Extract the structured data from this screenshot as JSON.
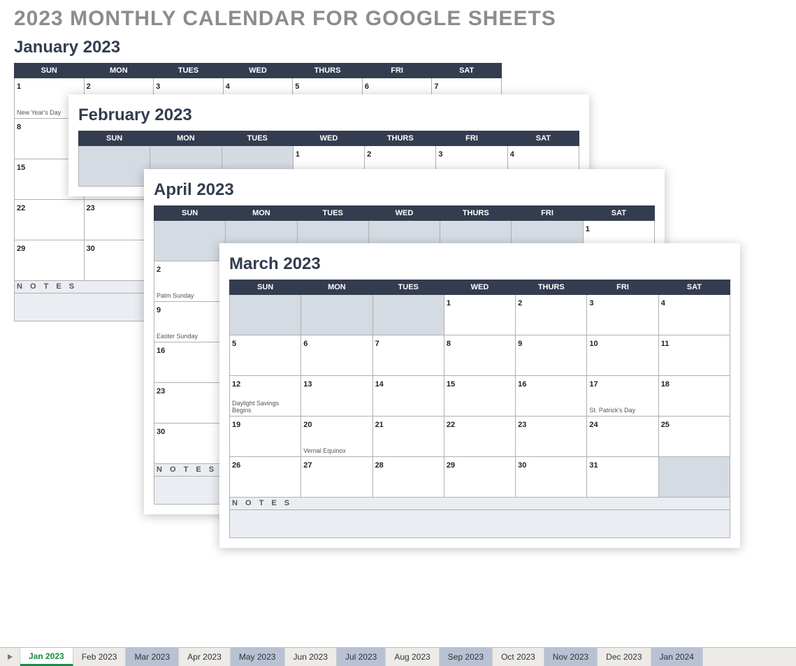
{
  "title": "2023 MONTHLY CALENDAR FOR GOOGLE SHEETS",
  "days": [
    "SUN",
    "MON",
    "TUES",
    "WED",
    "THURS",
    "FRI",
    "SAT"
  ],
  "notesLabel": "N O T E S",
  "calendars": {
    "jan": {
      "title": "January 2023",
      "startCol": 0,
      "daysInMonth": 31,
      "events": {
        "1": "New Year's Day"
      }
    },
    "feb": {
      "title": "February 2023",
      "startCol": 3,
      "daysInMonth": 28,
      "events": {}
    },
    "apr": {
      "title": "April 2023",
      "startCol": 6,
      "daysInMonth": 30,
      "events": {
        "2": "Palm Sunday",
        "9": "Easter Sunday"
      }
    },
    "mar": {
      "title": "March 2023",
      "startCol": 3,
      "daysInMonth": 31,
      "events": {
        "12": "Daylight Savings Begins",
        "17": "St. Patrick's Day",
        "20": "Vernal Equinox"
      }
    }
  },
  "tabs": [
    {
      "label": "Jan 2023",
      "active": true,
      "alt": false
    },
    {
      "label": "Feb 2023",
      "active": false,
      "alt": false
    },
    {
      "label": "Mar 2023",
      "active": false,
      "alt": true
    },
    {
      "label": "Apr 2023",
      "active": false,
      "alt": false
    },
    {
      "label": "May 2023",
      "active": false,
      "alt": true
    },
    {
      "label": "Jun 2023",
      "active": false,
      "alt": false
    },
    {
      "label": "Jul 2023",
      "active": false,
      "alt": true
    },
    {
      "label": "Aug 2023",
      "active": false,
      "alt": false
    },
    {
      "label": "Sep 2023",
      "active": false,
      "alt": true
    },
    {
      "label": "Oct 2023",
      "active": false,
      "alt": false
    },
    {
      "label": "Nov 2023",
      "active": false,
      "alt": true
    },
    {
      "label": "Dec 2023",
      "active": false,
      "alt": false
    },
    {
      "label": "Jan 2024",
      "active": false,
      "alt": true
    }
  ]
}
